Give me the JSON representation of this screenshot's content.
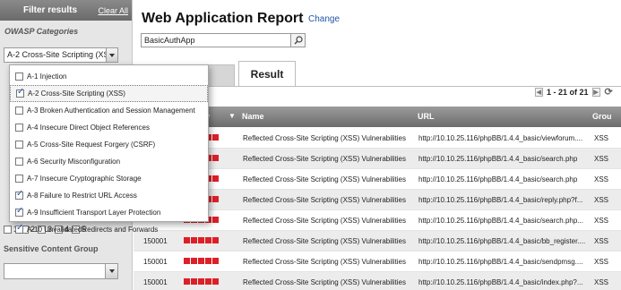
{
  "sidebar": {
    "title": "Filter results",
    "clear_all": "Clear All",
    "owasp_label": "OWASP Categories",
    "owasp_selected": "A-2 Cross-Site Scripting (XSS)",
    "severity_levels": [
      "1",
      "2",
      "3",
      "4",
      "5"
    ],
    "sensitive_label": "Sensitive Content Group",
    "sensitive_selected": ""
  },
  "dropdown": {
    "options": [
      {
        "label": "A-1 Injection",
        "checked": false
      },
      {
        "label": "A-2 Cross-Site Scripting (XSS)",
        "checked": true
      },
      {
        "label": "A-3 Broken Authentication and Session Management",
        "checked": false
      },
      {
        "label": "A-4 Insecure Direct Object References",
        "checked": false
      },
      {
        "label": "A-5 Cross-Site Request Forgery (CSRF)",
        "checked": false
      },
      {
        "label": "A-6 Security Misconfiguration",
        "checked": false
      },
      {
        "label": "A-7 Insecure Cryptographic Storage",
        "checked": false
      },
      {
        "label": "A-8 Failure to Restrict URL Access",
        "checked": true
      },
      {
        "label": "A-9 Insufficient Transport Layer Protection",
        "checked": true
      },
      {
        "label": "A-10 UnvalidatedRedirects and Forwards",
        "checked": true
      }
    ]
  },
  "header": {
    "title": "Web Application Report",
    "change": "Change",
    "app_value": "BasicAuthApp"
  },
  "tabs": {
    "active": "Result"
  },
  "pager": {
    "range": "1 - 21 of 21"
  },
  "table": {
    "columns": [
      "y",
      "Name",
      "URL",
      "Grou"
    ],
    "severity_color": "#dd1f28",
    "rows": [
      {
        "id": "",
        "name": "Reflected Cross-Site Scripting (XSS) Vulnerabilities",
        "url": "http://10.10.25.116/phpBB/1.4.4_basic/viewforum....",
        "group": "XSS"
      },
      {
        "id": "",
        "name": "Reflected Cross-Site Scripting (XSS) Vulnerabilities",
        "url": "http://10.10.25.116/phpBB/1.4.4_basic/search.php",
        "group": "XSS"
      },
      {
        "id": "",
        "name": "Reflected Cross-Site Scripting (XSS) Vulnerabilities",
        "url": "http://10.10.25.116/phpBB/1.4.4_basic/search.php",
        "group": "XSS"
      },
      {
        "id": "",
        "name": "Reflected Cross-Site Scripting (XSS) Vulnerabilities",
        "url": "http://10.10.25.116/phpBB/1.4.4_basic/reply.php?f...",
        "group": "XSS"
      },
      {
        "id": "",
        "name": "Reflected Cross-Site Scripting (XSS) Vulnerabilities",
        "url": "http://10.10.25.116/phpBB/1.4.4_basic/search.php...",
        "group": "XSS"
      },
      {
        "id": "150001",
        "name": "Reflected Cross-Site Scripting (XSS) Vulnerabilities",
        "url": "http://10.10.25.116/phpBB/1.4.4_basic/bb_register....",
        "group": "XSS"
      },
      {
        "id": "150001",
        "name": "Reflected Cross-Site Scripting (XSS) Vulnerabilities",
        "url": "http://10.10.25.116/phpBB/1.4.4_basic/sendpmsg....",
        "group": "XSS"
      },
      {
        "id": "150001",
        "name": "Reflected Cross-Site Scripting (XSS) Vulnerabilities",
        "url": "http://10.10.25.116/phpBB/1.4.4_basic/index.php?...",
        "group": "XSS"
      }
    ]
  }
}
